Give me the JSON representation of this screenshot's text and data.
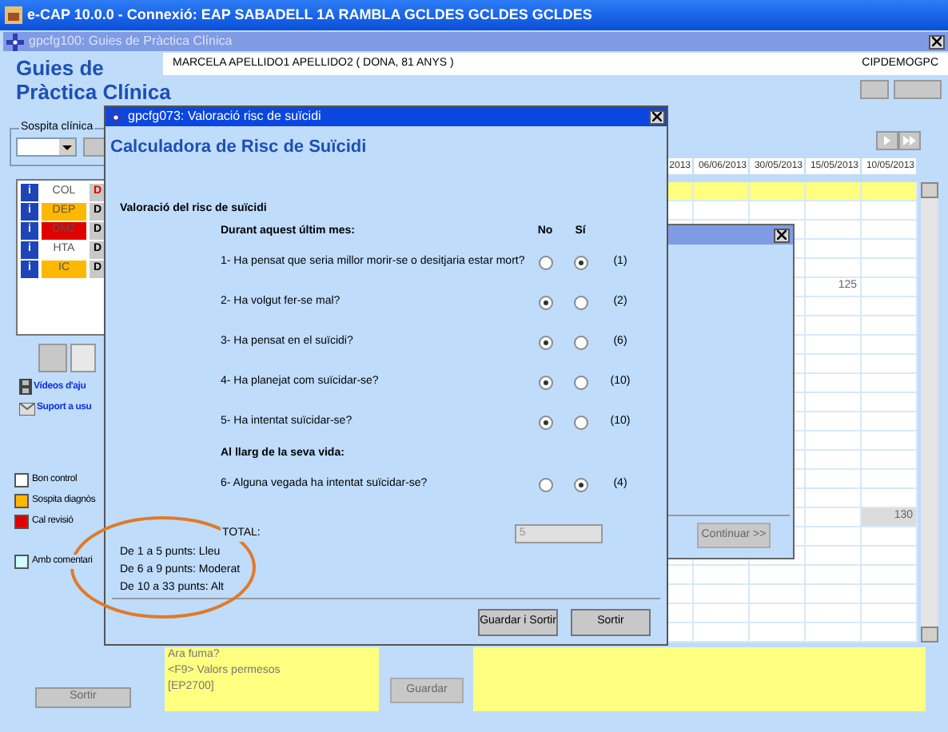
{
  "app_title": "e-CAP 10.0.0 - Connexió: EAP SABADELL 1A RAMBLA GCLDES GCLDES GCLDES",
  "window": {
    "title": "gpcfg100: Guies de Pràctica Clínica",
    "heading_lines": [
      "Guies de",
      "Pràctica Clínica"
    ],
    "patient": "MARCELA APELLIDO1 APELLIDO2 ( DONA, 81 ANYS )",
    "patient_code": "CIPDEMOGPC",
    "suspicion_group": "Sospita clínica",
    "conditions": [
      {
        "info": "i",
        "label": "COL",
        "color": "#ffffff",
        "badge": "D",
        "alert": true
      },
      {
        "info": "i",
        "label": "DEP",
        "color": "#ffb800",
        "badge": "D",
        "alert": false
      },
      {
        "info": "i",
        "label": "DM2",
        "color": "#e00000",
        "badge": "D",
        "alert": false
      },
      {
        "info": "i",
        "label": "HTA",
        "color": "#ffffff",
        "badge": "D",
        "alert": false
      },
      {
        "info": "i",
        "label": "IC",
        "color": "#ffb800",
        "badge": "D",
        "alert": false
      }
    ],
    "links": [
      {
        "kind": "video",
        "label": "Vídeos d'aju"
      },
      {
        "kind": "mail",
        "label": "Suport a usu"
      }
    ],
    "legend": [
      {
        "label": "Bon control",
        "color": "#ffffff"
      },
      {
        "label": "Sospita diagnòs",
        "color": "#ffb800"
      },
      {
        "label": "Cal revisió",
        "color": "#e00000"
      },
      {
        "label": "Amb comentari",
        "color": "#ccffff"
      }
    ],
    "exit_button": "Sortir",
    "grid": {
      "columns": [
        "2013",
        "06/06/2013",
        "30/05/2013",
        "15/05/2013",
        "10/05/2013"
      ],
      "values": [
        {
          "text": "125",
          "shaded": false
        },
        {
          "text": "130",
          "shaded": true
        }
      ]
    },
    "help_lines": [
      "Ara fuma?",
      "<F9> Valors permesos",
      "[EP2700]"
    ],
    "save_button": "Guardar"
  },
  "middle_dialog": {
    "continue_button": "Continuar >>"
  },
  "dialog": {
    "title": "gpcfg073: Valoració risc de suïcidi",
    "heading": "Calculadora de Risc de Suïcidi",
    "section": "Valoració del risc de suïcidi",
    "column_headers": [
      "No",
      "Sí"
    ],
    "groups": [
      {
        "heading": "Durant aquest últim mes:",
        "questions": [
          {
            "text": "1- Ha pensat que seria millor morir-se o desitjaria estar mort?",
            "points": "(1)",
            "options": [
              {
                "selected": false
              },
              {
                "selected": true
              }
            ]
          },
          {
            "text": "2- Ha volgut fer-se mal?",
            "points": "(2)",
            "options": [
              {
                "selected": true
              },
              {
                "selected": false
              }
            ]
          },
          {
            "text": "3- Ha pensat en el suïcidi?",
            "points": "(6)",
            "options": [
              {
                "selected": true
              },
              {
                "selected": false
              }
            ]
          },
          {
            "text": "4- Ha planejat com suïcidar-se?",
            "points": "(10)",
            "options": [
              {
                "selected": true
              },
              {
                "selected": false
              }
            ]
          },
          {
            "text": "5- Ha intentat suïcidar-se?",
            "points": "(10)",
            "options": [
              {
                "selected": true
              },
              {
                "selected": false
              }
            ]
          }
        ]
      },
      {
        "heading": "Al llarg de la seva vida:",
        "questions": [
          {
            "text": "6- Alguna vegada ha intentat suïcidar-se?",
            "points": "(4)",
            "options": [
              {
                "selected": false
              },
              {
                "selected": true
              }
            ]
          }
        ]
      }
    ],
    "total_label": "TOTAL:",
    "total_value": "5",
    "scale": [
      "De 1 a 5 punts: Lleu",
      "De 6 a 9 punts: Moderat",
      "De 10 a 33 punts: Alt"
    ],
    "buttons": [
      "Guardar i Sortir",
      "Sortir"
    ]
  }
}
